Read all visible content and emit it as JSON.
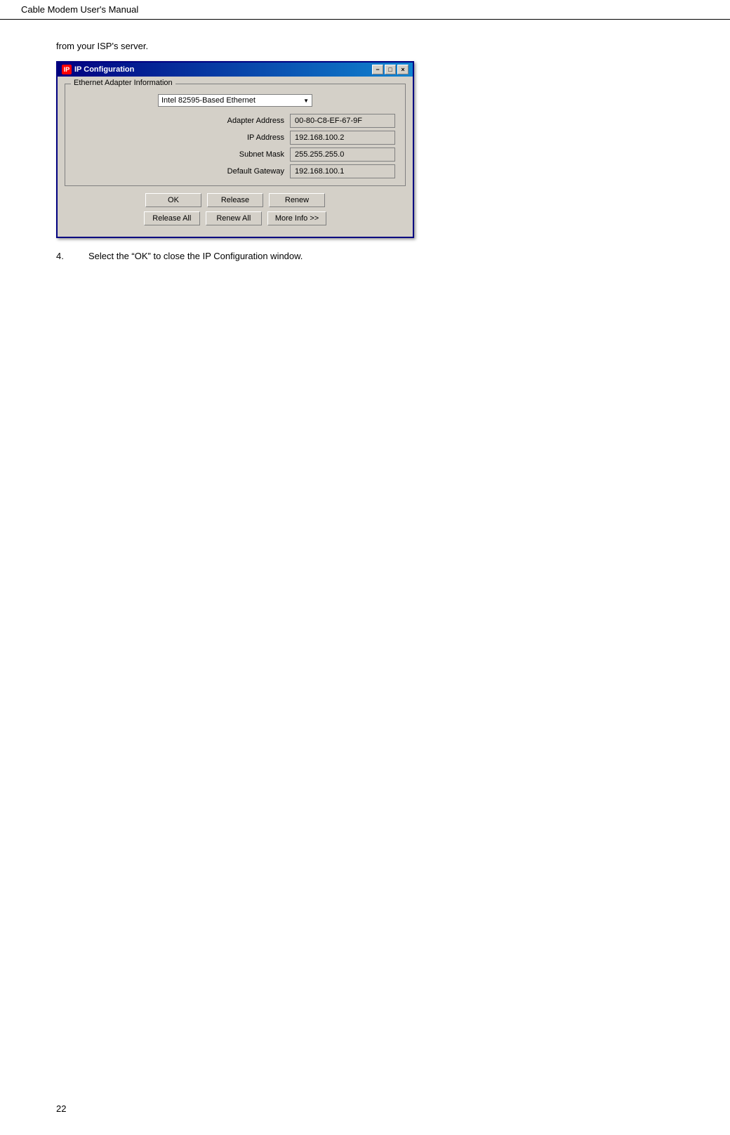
{
  "header": {
    "title": "Cable Modem User's Manual"
  },
  "footer": {
    "page_number": "22"
  },
  "content": {
    "intro": "from your ISP's server.",
    "step4_number": "4.",
    "step4_text": "Select the “OK” to close the IP Configuration window."
  },
  "dialog": {
    "title": "IP Configuration",
    "icon_label": "IP",
    "titlebar_buttons": {
      "minimize": "−",
      "maximize": "□",
      "close": "×"
    },
    "groupbox_title": "Ethernet Adapter Information",
    "adapter_label": "Intel 82595-Based Ethernet",
    "fields": [
      {
        "label": "Adapter Address",
        "value": "00-80-C8-EF-67-9F"
      },
      {
        "label": "IP Address",
        "value": "192.168.100.2"
      },
      {
        "label": "Subnet Mask",
        "value": "255.255.255.0"
      },
      {
        "label": "Default Gateway",
        "value": "192.168.100.1"
      }
    ],
    "buttons_row1": [
      {
        "label": "OK",
        "name": "ok-button"
      },
      {
        "label": "Release",
        "name": "release-button"
      },
      {
        "label": "Renew",
        "name": "renew-button"
      }
    ],
    "buttons_row2": [
      {
        "label": "Release All",
        "name": "release-all-button"
      },
      {
        "label": "Renew All",
        "name": "renew-all-button"
      },
      {
        "label": "More Info >>",
        "name": "more-info-button"
      }
    ]
  }
}
